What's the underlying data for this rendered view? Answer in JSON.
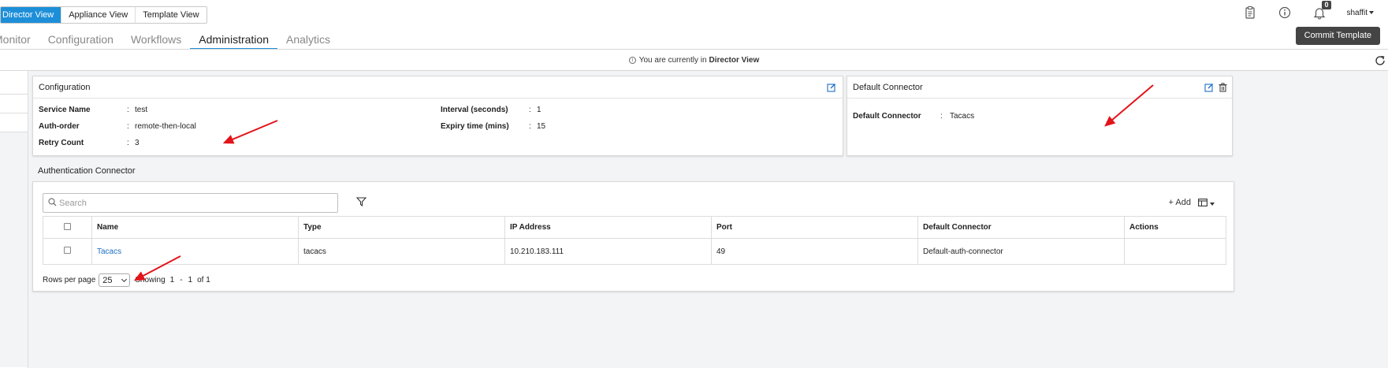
{
  "view_switcher": {
    "items": [
      "Director View",
      "Appliance View",
      "Template View"
    ],
    "active": "Director View"
  },
  "top_icons": {
    "notification_count": "0",
    "user": "shaffit"
  },
  "tabs": [
    {
      "label": "Monitor",
      "active": false
    },
    {
      "label": "Configuration",
      "active": false
    },
    {
      "label": "Workflows",
      "active": false
    },
    {
      "label": "Administration",
      "active": true
    },
    {
      "label": "Analytics",
      "active": false
    }
  ],
  "commit_button": "Commit Template",
  "info_bar": {
    "prefix": "You are currently in",
    "view": "Director View"
  },
  "configuration": {
    "title": "Configuration",
    "left": [
      {
        "label": "Service Name",
        "value": "test"
      },
      {
        "label": "Auth-order",
        "value": "remote-then-local"
      },
      {
        "label": "Retry Count",
        "value": "3"
      }
    ],
    "right": [
      {
        "label": "Interval (seconds)",
        "value": "1"
      },
      {
        "label": "Expiry time (mins)",
        "value": "15"
      }
    ]
  },
  "default_connector": {
    "title": "Default Connector",
    "label": "Default Connector",
    "value": "Tacacs"
  },
  "auth_connector": {
    "title": "Authentication Connector",
    "search_placeholder": "Search",
    "add_label": "+ Add",
    "columns": [
      "Name",
      "Type",
      "IP Address",
      "Port",
      "Default Connector",
      "Actions"
    ],
    "rows": [
      {
        "name": "Tacacs",
        "type": "tacacs",
        "ip": "10.210.183.111",
        "port": "49",
        "default_connector": "Default-auth-connector",
        "actions": ""
      }
    ],
    "pager": {
      "rows_per_page_label": "Rows per page",
      "rows_per_page": "25",
      "showing_label": "Showing",
      "from": "1",
      "dash": "-",
      "to": "1",
      "of_label": "of 1"
    }
  },
  "colors": {
    "accent": "#1d8fd8",
    "link": "#1d6ec5",
    "annotation_arrow": "#e3141a",
    "commit_bg": "#444444"
  }
}
